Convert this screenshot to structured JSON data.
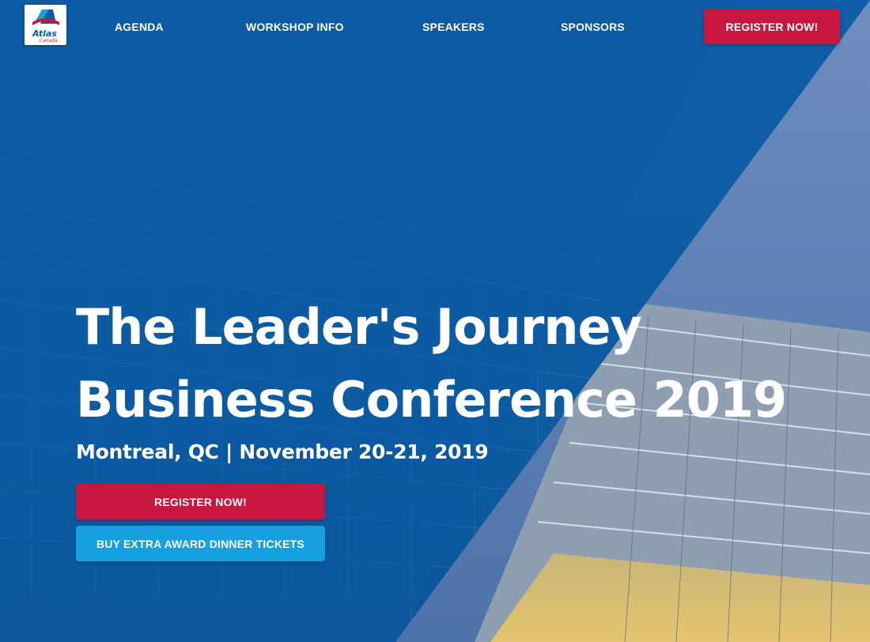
{
  "nav": {
    "logo": {
      "text": "Atlas",
      "subtext": "Canada"
    },
    "links": [
      {
        "label": "AGENDA"
      },
      {
        "label": "WORKSHOP INFO"
      },
      {
        "label": "SPEAKERS"
      },
      {
        "label": "SPONSORS"
      }
    ],
    "cta_label": "REGISTER NOW!"
  },
  "hero": {
    "title_line1": "The Leader's Journey",
    "title_line2": "Business Conference 2019",
    "subtitle": "Montreal, QC | November 20-21, 2019",
    "register_label": "REGISTER NOW!",
    "tickets_label": "BUY EXTRA AWARD DINNER TICKETS"
  },
  "colors": {
    "hero_blue": "#0e5ea8",
    "cta_red": "#c8173f",
    "ticket_blue": "#16a0e0"
  }
}
